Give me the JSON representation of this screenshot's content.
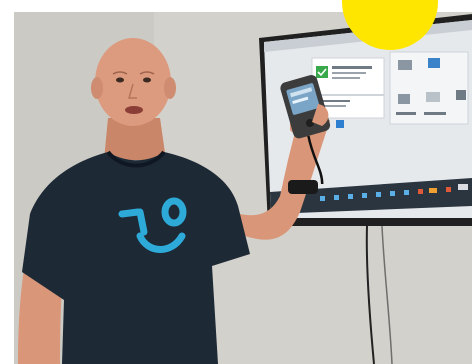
{
  "colors": {
    "wall": "#d4d2cc",
    "wall_shadow": "#c2c0ba",
    "tv_bezel": "#262626",
    "tv_screen": "#e8eaec",
    "taskbar": "#2f3a44",
    "shirt": "#1e2a36",
    "logo": "#2ea8d9",
    "skin": "#d9967a",
    "device": "#3a3a3a",
    "device_screen": "#6a8fb0",
    "sun": "#ffe600"
  },
  "icons": [
    "check-icon",
    "sun-circle",
    "smile-logo-icon"
  ]
}
